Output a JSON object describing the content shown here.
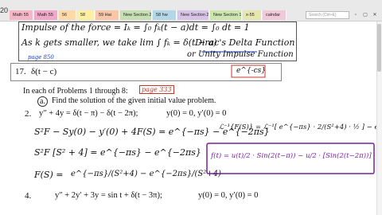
{
  "window": {
    "app_title": "20",
    "search_placeholder": "Search (Ctrl+E)"
  },
  "tabs": [
    {
      "label": "Math 55",
      "color": "#f5b6c8"
    },
    {
      "label": "Math 55",
      "color": "#f3a8c9"
    },
    {
      "label": "56",
      "color": "#ffd9a8"
    },
    {
      "label": "58",
      "color": "#fff0a0"
    },
    {
      "label": "59 Hai",
      "color": "#f9c6a8"
    },
    {
      "label": "New Section 2",
      "color": "#c6e0b4"
    },
    {
      "label": "58 hw",
      "color": "#b4d7e8"
    },
    {
      "label": "New Section 2",
      "color": "#d9c3e6"
    },
    {
      "label": "New Section 1",
      "color": "#cde6b0"
    },
    {
      "label": "x-55",
      "color": "#e6e6b0"
    },
    {
      "label": "calndar",
      "color": "#f2c9d9"
    }
  ],
  "notes": {
    "impulse_line": "Impulse of the force = Iₖ = ∫₀ fₖ(t − a)dt = ∫₀ dt = 1",
    "as_k_line": "As k gets smaller, we take lim ∫ fₖ = δ(t − a)",
    "dirac_label": "Dirac's Delta Function",
    "unity_label": "or Unity Impulse Function",
    "page_ref_1": "page 850",
    "problem_17_number": "17.",
    "problem_17_expr": "δ(t − c)",
    "problem_17_answer": "e^{-cs}",
    "instructions": "In each of Problems 1 through 8:",
    "page_ref_2": "page 333",
    "part_a": "a.",
    "part_a_text": "Find the solution of the given initial value problem.",
    "problem_2_number": "2.",
    "problem_2_eq": "y″ + 4y = δ(t − π) − δ(t − 2π);",
    "problem_2_ic": "y(0) = 0,  y′(0) = 0",
    "work_line_1": "S²F − Sy(0) − y′(0) + 4F(S) = e^{−πs} − e^{−2πs}",
    "work_line_2": "S²F [S² + 4] = e^{−πs} − e^{−2πs}",
    "work_line_3_lhs": "F(S) =",
    "work_line_3_rhs": "e^{−πs}/(S²+4) − e^{−2πs}/(S²+4)",
    "inverse_line": "ℒ⁻¹{F(S)} = ℒ⁻¹[ e^{−πs} · 2/(S²+4) · ½ ] − e^{−2πs}[ 2/(S²+4) · ½ ]",
    "result_box": "f(t) = u(t)/2 · Sin(2(t−π)) − u/2 · [Sin(2(t−2π))]",
    "problem_4_number": "4.",
    "problem_4_eq": "y″ + 2y′ + 3y = sin t + δ(t − 3π);",
    "problem_4_ic": "y(0) = 0,  y′(0) = 0"
  }
}
